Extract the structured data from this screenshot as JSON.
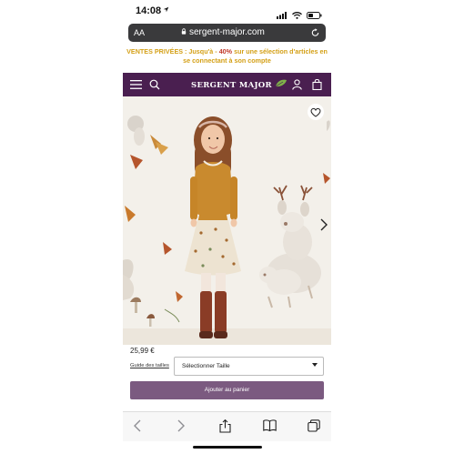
{
  "status": {
    "time": "14:08",
    "location_icon": "location-arrow-icon"
  },
  "browser": {
    "text_size_label": "AA",
    "url": "sergent-major.com"
  },
  "promo": {
    "part1": "VENTES PRIVÉES : Jusqu'à - ",
    "percent": "40%",
    "part2": " sur une sélection d'articles en se connectant à son compte"
  },
  "header": {
    "logo_text": "SERGENT MAJOR"
  },
  "product": {
    "price": "25,99 €",
    "size_guide": "Guide des tailles",
    "size_select": "Sélectionner Taille",
    "add_to_cart": "Ajouter au panier"
  },
  "colors": {
    "nav": "#4a1f50",
    "cart_button": "#7b5a80",
    "promo": "#d4a017",
    "promo_percent": "#c0392b"
  }
}
